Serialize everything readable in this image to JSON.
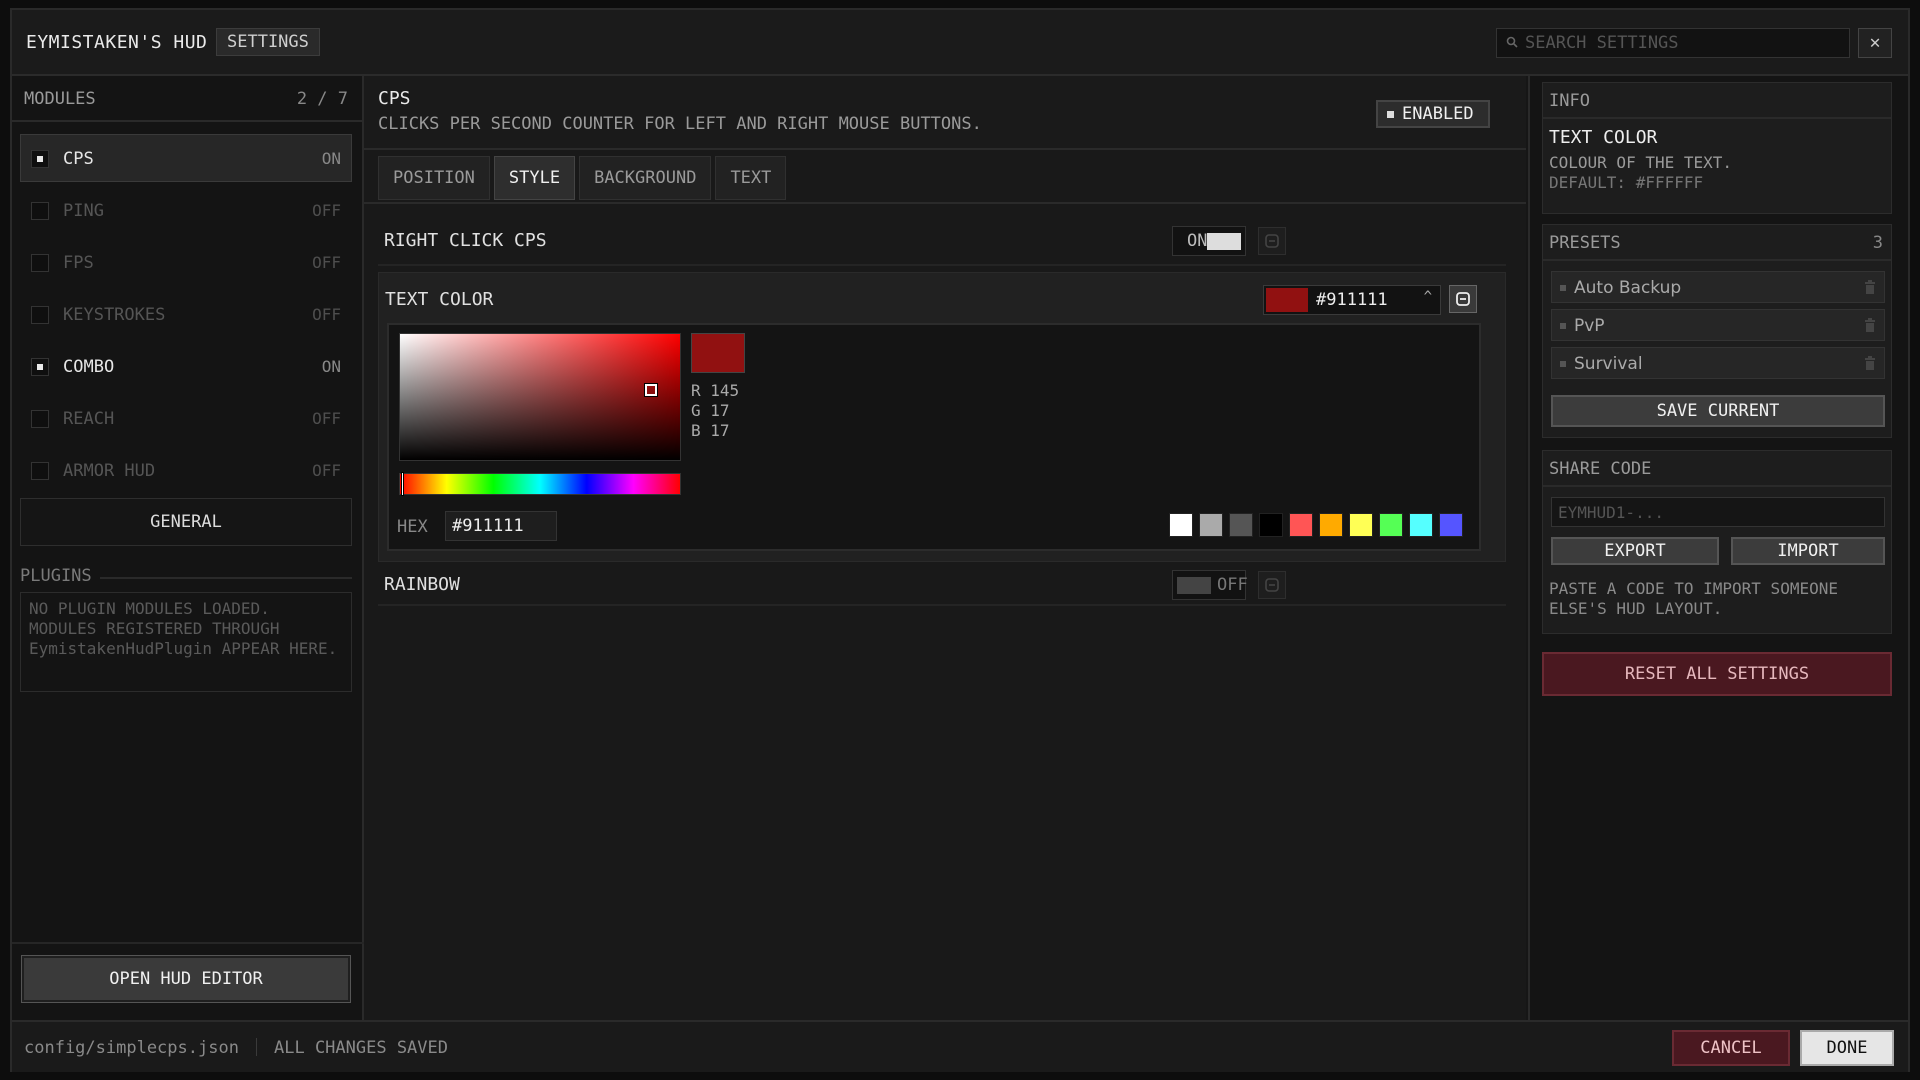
{
  "header": {
    "app_title": "EYMISTAKEN'S HUD",
    "badge": "SETTINGS",
    "search_placeholder": "SEARCH SETTINGS",
    "close_glyph": "✕"
  },
  "sidebar": {
    "modules_label": "MODULES",
    "modules_count": "2 / 7",
    "modules": [
      {
        "name": "CPS",
        "state": "ON",
        "enabled": true,
        "selected": true
      },
      {
        "name": "PING",
        "state": "OFF",
        "enabled": false,
        "selected": false
      },
      {
        "name": "FPS",
        "state": "OFF",
        "enabled": false,
        "selected": false
      },
      {
        "name": "KEYSTROKES",
        "state": "OFF",
        "enabled": false,
        "selected": false
      },
      {
        "name": "COMBO",
        "state": "ON",
        "enabled": true,
        "selected": false
      },
      {
        "name": "REACH",
        "state": "OFF",
        "enabled": false,
        "selected": false
      },
      {
        "name": "ARMOR HUD",
        "state": "OFF",
        "enabled": false,
        "selected": false
      }
    ],
    "general_label": "GENERAL",
    "plugins_label": "PLUGINS",
    "plugins_note": "NO PLUGIN MODULES LOADED. MODULES REGISTERED THROUGH EymistakenHudPlugin APPEAR HERE.",
    "open_editor_label": "OPEN HUD EDITOR"
  },
  "main": {
    "module_title": "CPS",
    "module_desc": "CLICKS PER SECOND COUNTER FOR LEFT AND RIGHT MOUSE BUTTONS.",
    "enabled_label": "ENABLED",
    "tabs": [
      {
        "label": "POSITION",
        "active": false
      },
      {
        "label": "STYLE",
        "active": true
      },
      {
        "label": "BACKGROUND",
        "active": false
      },
      {
        "label": "TEXT",
        "active": false
      }
    ],
    "settings": {
      "right_click_cps": {
        "label": "RIGHT CLICK CPS",
        "state": "ON",
        "on": true
      },
      "text_color": {
        "label": "TEXT COLOR",
        "hex": "#911111",
        "r_label": "R 145",
        "g_label": "G 17",
        "b_label": "B 17",
        "hex_field_label": "HEX",
        "hex_field_value": "#911111"
      },
      "rainbow": {
        "label": "RAINBOW",
        "state": "OFF",
        "on": false
      }
    },
    "swatches": [
      "#ffffff",
      "#aaaaaa",
      "#555555",
      "#000000",
      "#ff5555",
      "#ffaa00",
      "#ffff55",
      "#55ff55",
      "#55ffff",
      "#5555ff"
    ]
  },
  "right": {
    "info": {
      "label": "INFO",
      "title": "TEXT COLOR",
      "desc_line1": "COLOUR OF THE TEXT.",
      "desc_line2": "DEFAULT: #FFFFFF"
    },
    "presets": {
      "label": "PRESETS",
      "count": "3",
      "items": [
        "Auto Backup",
        "PvP",
        "Survival"
      ],
      "save_label": "SAVE CURRENT"
    },
    "share": {
      "label": "SHARE CODE",
      "placeholder": "EYMHUD1-...",
      "export_label": "EXPORT",
      "import_label": "IMPORT",
      "note": "PASTE A CODE TO IMPORT SOMEONE ELSE'S HUD LAYOUT."
    },
    "reset_all_label": "RESET ALL SETTINGS"
  },
  "footer": {
    "config_path": "config/simplecps.json",
    "status": "ALL CHANGES SAVED",
    "cancel_label": "CANCEL",
    "done_label": "DONE"
  },
  "colors": {
    "text_color": "#911111",
    "toggle_on_knob": "#dddddd",
    "toggle_off_knob": "#444444",
    "danger": "#4a1820"
  }
}
